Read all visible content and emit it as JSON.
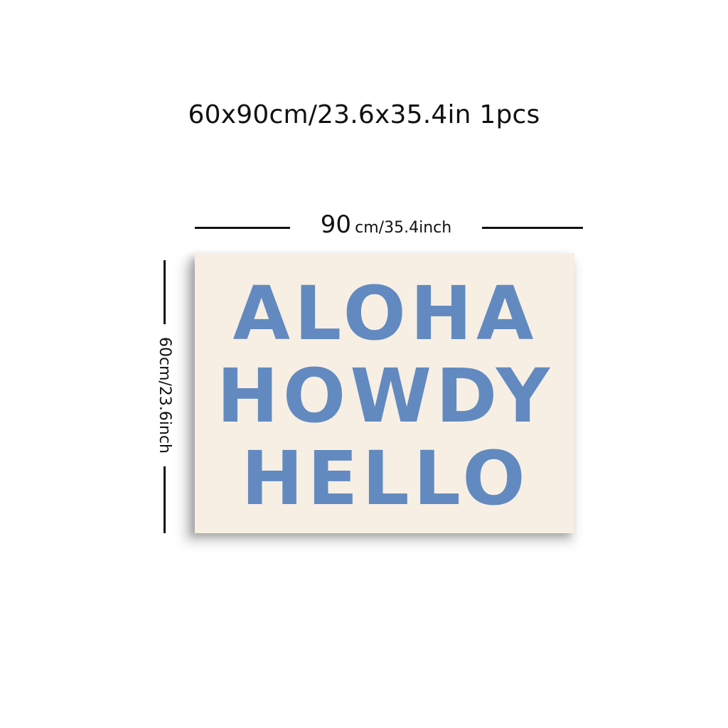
{
  "title": "60x90cm/23.6x35.4in 1pcs",
  "dimensions": {
    "width_number": "90",
    "width_unit": "cm/35.4inch",
    "height_label": "60cm/23.6inch"
  },
  "artwork": {
    "lines": [
      "ALOHA",
      "HOWDY",
      "HELLO"
    ],
    "background_color": "#f7efe3",
    "text_color": "#5b85bf"
  }
}
